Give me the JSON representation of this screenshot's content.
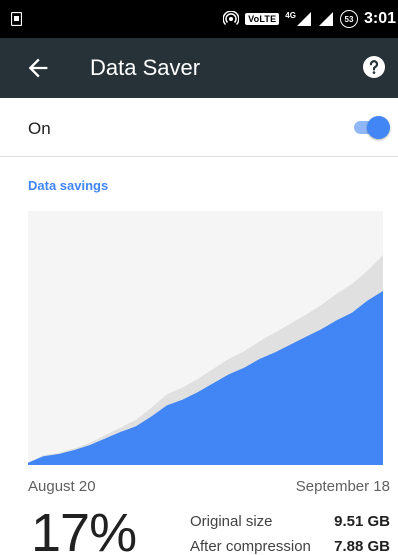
{
  "status_bar": {
    "volte": "VoLTE",
    "network": "4G",
    "battery": "53",
    "time": "3:01"
  },
  "app_bar": {
    "title": "Data Saver",
    "back_icon": "arrow-back-icon",
    "help_icon": "help-icon"
  },
  "toggle": {
    "label": "On",
    "state": true
  },
  "section": {
    "header": "Data savings"
  },
  "chart": {
    "start_date": "August 20",
    "end_date": "September 18"
  },
  "chart_data": {
    "type": "area",
    "x": [
      "August 20",
      "September 18"
    ],
    "series": [
      {
        "values": [
          0.1,
          0.45,
          0.55,
          0.75,
          1.0,
          1.35,
          1.7,
          2.05,
          2.6,
          3.2,
          3.5,
          3.9,
          4.35,
          4.8,
          5.15,
          5.6,
          6.0,
          6.4,
          6.8,
          7.25,
          7.75,
          8.2,
          8.8,
          9.51
        ]
      },
      {
        "values": [
          0.1,
          0.4,
          0.5,
          0.68,
          0.9,
          1.2,
          1.5,
          1.75,
          2.2,
          2.7,
          2.95,
          3.3,
          3.7,
          4.1,
          4.4,
          4.8,
          5.1,
          5.45,
          5.8,
          6.15,
          6.55,
          6.9,
          7.45,
          7.88
        ]
      }
    ],
    "colors": [
      "#e0e0e0",
      "#4285f4"
    ],
    "ylim": [
      0,
      11.5
    ],
    "grid": false
  },
  "summary": {
    "percent": "17%",
    "original_label": "Original size",
    "original_value": "9.51 GB",
    "compressed_label": "After compression",
    "compressed_value": "7.88 GB"
  }
}
